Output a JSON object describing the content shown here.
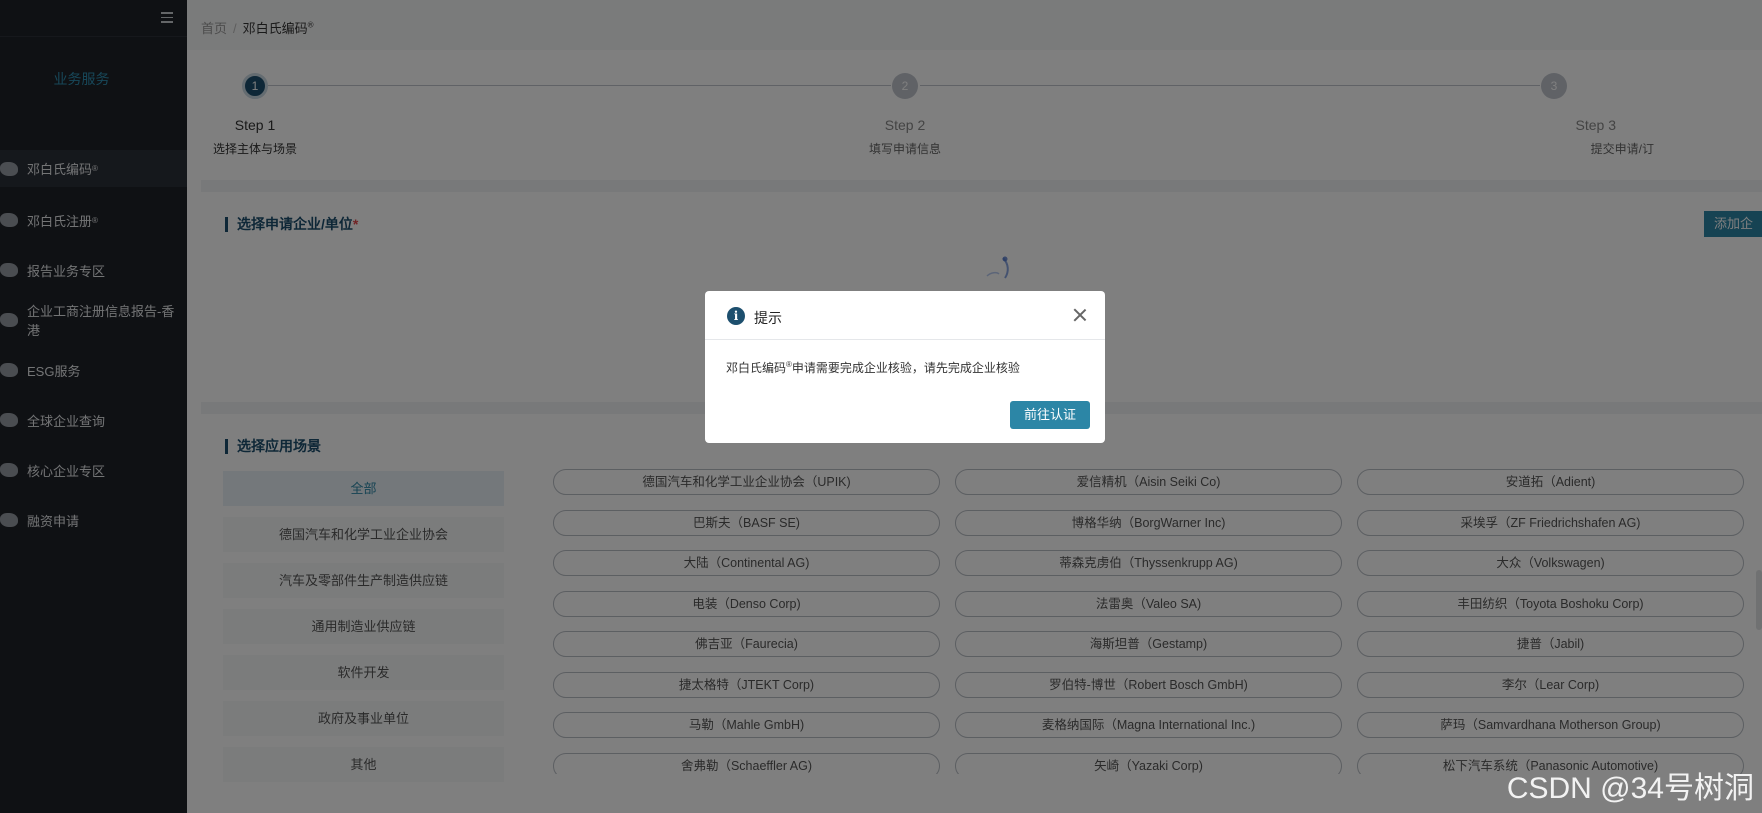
{
  "sidebar": {
    "section_title": "业务服务",
    "items": [
      {
        "label": "邓白氏编码",
        "sup": "®",
        "active": true
      },
      {
        "label": "邓白氏注册",
        "sup": "®"
      },
      {
        "label": "报告业务专区"
      },
      {
        "label": "企业工商注册信息报告-香港"
      },
      {
        "label": "ESG服务"
      },
      {
        "label": "全球企业查询"
      },
      {
        "label": "核心企业专区"
      },
      {
        "label": "融资申请"
      }
    ]
  },
  "breadcrumb": {
    "home": "首页",
    "sep": "/",
    "current": "邓白氏编码",
    "current_sup": "®"
  },
  "steps": [
    {
      "num": "1",
      "title": "Step 1",
      "sub": "选择主体与场景"
    },
    {
      "num": "2",
      "title": "Step 2",
      "sub": "填写申请信息"
    },
    {
      "num": "3",
      "title": "Step 3",
      "sub": "提交申请/订"
    }
  ],
  "company_section": {
    "title": "选择申请企业/单位",
    "required": "*",
    "add_button": "添加企"
  },
  "scene_section": {
    "title": "选择应用场景",
    "categories": [
      "全部",
      "德国汽车和化学工业企业协会",
      "汽车及零部件生产制造供应链",
      "通用制造业供应链",
      "软件开发",
      "政府及事业单位",
      "其他"
    ],
    "tags": [
      "德国汽车和化学工业企业协会（UPIK)",
      "爱信精机（Aisin Seiki Co)",
      "安道拓（Adient)",
      "巴斯夫（BASF SE)",
      "博格华纳（BorgWarner Inc)",
      "采埃孚（ZF Friedrichshafen AG)",
      "大陆（Continental AG)",
      "蒂森克虏伯（Thyssenkrupp AG)",
      "大众（Volkswagen)",
      "电装（Denso Corp)",
      "法雷奥（Valeo SA)",
      "丰田纺织（Toyota Boshoku Corp)",
      "佛吉亚（Faurecia)",
      "海斯坦普（Gestamp)",
      "捷普（Jabil)",
      "捷太格特（JTEKT Corp)",
      "罗伯特-博世（Robert Bosch GmbH)",
      "李尔（Lear Corp)",
      "马勒（Mahle GmbH)",
      "麦格纳国际（Magna International Inc.)",
      "萨玛（Samvardhana Motherson Group)",
      "舍弗勒（Schaeffler AG)",
      "矢崎（Yazaki Corp)",
      "松下汽车系统（Panasonic Automotive)"
    ]
  },
  "dialog": {
    "title": "提示",
    "info_glyph": "i",
    "message_prefix": "邓白氏编码",
    "message_sup": "®",
    "message_suffix": "申请需要完成企业核验，请先完成企业核验",
    "confirm": "前往认证"
  },
  "watermark": "CSDN @34号树洞",
  "colors": {
    "brand": "#1d4f6e",
    "accent": "#2c86a6",
    "sidebar_bg": "#1f2329"
  }
}
